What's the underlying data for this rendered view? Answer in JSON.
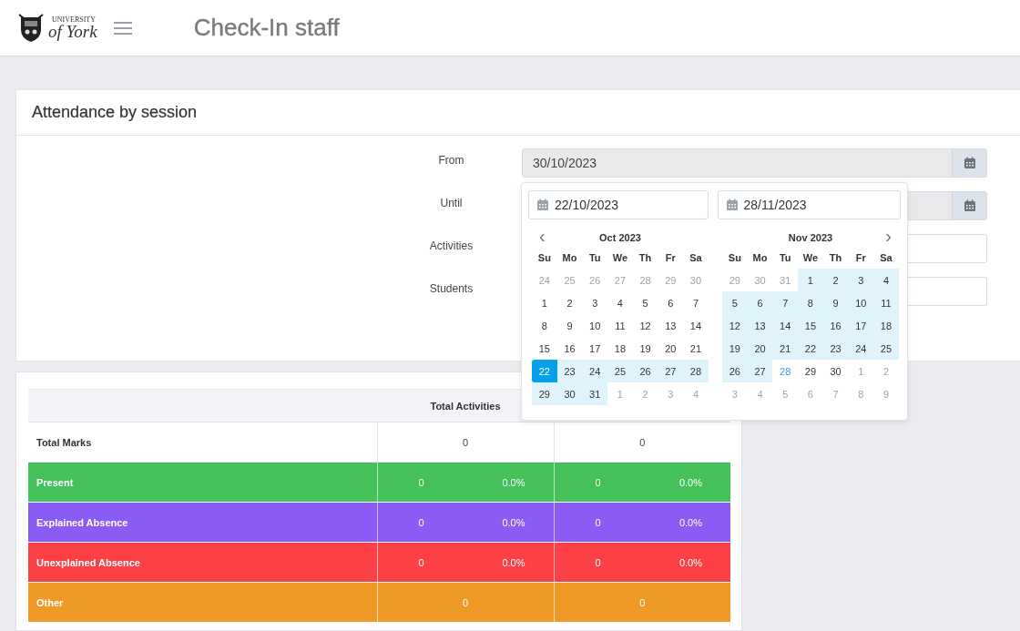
{
  "header": {
    "logo": {
      "line_1": "UNIVERSITY",
      "line_2": "of York"
    },
    "title": "Check-In staff"
  },
  "filter_card": {
    "title": "Attendance by session",
    "fields": [
      {
        "label": "From",
        "value": "30/10/2023",
        "kind": "date"
      },
      {
        "label": "Until",
        "kind": "date"
      },
      {
        "label": "Activities",
        "kind": "text"
      },
      {
        "label": "Students",
        "kind": "text"
      }
    ]
  },
  "date_picker": {
    "start_input": "22/10/2023",
    "end_input": "28/11/2023",
    "prev": "‹",
    "next": "›",
    "months": [
      {
        "title": "Oct 2023",
        "weekdays": [
          "Su",
          "Mo",
          "Tu",
          "We",
          "Th",
          "Fr",
          "Sa"
        ],
        "weeks": [
          [
            {
              "day": "24",
              "kind": "other"
            },
            {
              "day": "25",
              "kind": "other"
            },
            {
              "day": "26",
              "kind": "other"
            },
            {
              "day": "27",
              "kind": "other"
            },
            {
              "day": "28",
              "kind": "other"
            },
            {
              "day": "29",
              "kind": "other"
            },
            {
              "day": "30",
              "kind": "other"
            }
          ],
          [
            {
              "day": "1",
              "kind": "day"
            },
            {
              "day": "2",
              "kind": "day"
            },
            {
              "day": "3",
              "kind": "day"
            },
            {
              "day": "4",
              "kind": "day"
            },
            {
              "day": "5",
              "kind": "day"
            },
            {
              "day": "6",
              "kind": "day"
            },
            {
              "day": "7",
              "kind": "day"
            }
          ],
          [
            {
              "day": "8",
              "kind": "day"
            },
            {
              "day": "9",
              "kind": "day"
            },
            {
              "day": "10",
              "kind": "day"
            },
            {
              "day": "11",
              "kind": "day"
            },
            {
              "day": "12",
              "kind": "day"
            },
            {
              "day": "13",
              "kind": "day"
            },
            {
              "day": "14",
              "kind": "day"
            }
          ],
          [
            {
              "day": "15",
              "kind": "day"
            },
            {
              "day": "16",
              "kind": "day"
            },
            {
              "day": "17",
              "kind": "day"
            },
            {
              "day": "18",
              "kind": "day"
            },
            {
              "day": "19",
              "kind": "day"
            },
            {
              "day": "20",
              "kind": "day"
            },
            {
              "day": "21",
              "kind": "day"
            }
          ],
          [
            {
              "day": "22",
              "kind": "start"
            },
            {
              "day": "23",
              "kind": "range"
            },
            {
              "day": "24",
              "kind": "range"
            },
            {
              "day": "25",
              "kind": "range"
            },
            {
              "day": "26",
              "kind": "range"
            },
            {
              "day": "27",
              "kind": "range"
            },
            {
              "day": "28",
              "kind": "range"
            }
          ],
          [
            {
              "day": "29",
              "kind": "range"
            },
            {
              "day": "30",
              "kind": "range"
            },
            {
              "day": "31",
              "kind": "range"
            },
            {
              "day": "1",
              "kind": "other"
            },
            {
              "day": "2",
              "kind": "other"
            },
            {
              "day": "3",
              "kind": "other"
            },
            {
              "day": "4",
              "kind": "other"
            }
          ]
        ]
      },
      {
        "title": "Nov 2023",
        "weekdays": [
          "Su",
          "Mo",
          "Tu",
          "We",
          "Th",
          "Fr",
          "Sa"
        ],
        "weeks": [
          [
            {
              "day": "29",
              "kind": "other"
            },
            {
              "day": "30",
              "kind": "other"
            },
            {
              "day": "31",
              "kind": "other"
            },
            {
              "day": "1",
              "kind": "range"
            },
            {
              "day": "2",
              "kind": "range"
            },
            {
              "day": "3",
              "kind": "range"
            },
            {
              "day": "4",
              "kind": "range"
            }
          ],
          [
            {
              "day": "5",
              "kind": "range"
            },
            {
              "day": "6",
              "kind": "range"
            },
            {
              "day": "7",
              "kind": "range"
            },
            {
              "day": "8",
              "kind": "range"
            },
            {
              "day": "9",
              "kind": "range"
            },
            {
              "day": "10",
              "kind": "range"
            },
            {
              "day": "11",
              "kind": "range"
            }
          ],
          [
            {
              "day": "12",
              "kind": "range"
            },
            {
              "day": "13",
              "kind": "range"
            },
            {
              "day": "14",
              "kind": "range"
            },
            {
              "day": "15",
              "kind": "range"
            },
            {
              "day": "16",
              "kind": "range"
            },
            {
              "day": "17",
              "kind": "range"
            },
            {
              "day": "18",
              "kind": "range"
            }
          ],
          [
            {
              "day": "19",
              "kind": "range"
            },
            {
              "day": "20",
              "kind": "range"
            },
            {
              "day": "21",
              "kind": "range"
            },
            {
              "day": "22",
              "kind": "range"
            },
            {
              "day": "23",
              "kind": "range"
            },
            {
              "day": "24",
              "kind": "range"
            },
            {
              "day": "25",
              "kind": "range"
            }
          ],
          [
            {
              "day": "26",
              "kind": "range"
            },
            {
              "day": "27",
              "kind": "range"
            },
            {
              "day": "28",
              "kind": "end"
            },
            {
              "day": "29",
              "kind": "day"
            },
            {
              "day": "30",
              "kind": "day"
            },
            {
              "day": "1",
              "kind": "other"
            },
            {
              "day": "2",
              "kind": "other"
            }
          ],
          [
            {
              "day": "3",
              "kind": "other"
            },
            {
              "day": "4",
              "kind": "other"
            },
            {
              "day": "5",
              "kind": "other"
            },
            {
              "day": "6",
              "kind": "other"
            },
            {
              "day": "7",
              "kind": "other"
            },
            {
              "day": "8",
              "kind": "other"
            },
            {
              "day": "9",
              "kind": "other"
            }
          ]
        ]
      }
    ]
  },
  "stats_table": {
    "header": "Total Activities",
    "rows": [
      {
        "label": "Total Marks",
        "kind": "total",
        "values": [
          "0",
          "0"
        ]
      },
      {
        "label": "Present",
        "kind": "split",
        "color": "#44c15a",
        "values": [
          {
            "count": "0",
            "percent": "0.0%"
          },
          {
            "count": "0",
            "percent": "0.0%"
          }
        ]
      },
      {
        "label": "Explained Absence",
        "kind": "split",
        "color": "#8a5cf3",
        "values": [
          {
            "count": "0",
            "percent": "0.0%"
          },
          {
            "count": "0",
            "percent": "0.0%"
          }
        ]
      },
      {
        "label": "Unexplained Absence",
        "kind": "split",
        "color": "#fb4046",
        "values": [
          {
            "count": "0",
            "percent": "0.0%"
          },
          {
            "count": "0",
            "percent": "0.0%"
          }
        ]
      },
      {
        "label": "Other",
        "kind": "total",
        "color": "#ef9a26",
        "values": [
          "0",
          "0"
        ]
      }
    ]
  }
}
